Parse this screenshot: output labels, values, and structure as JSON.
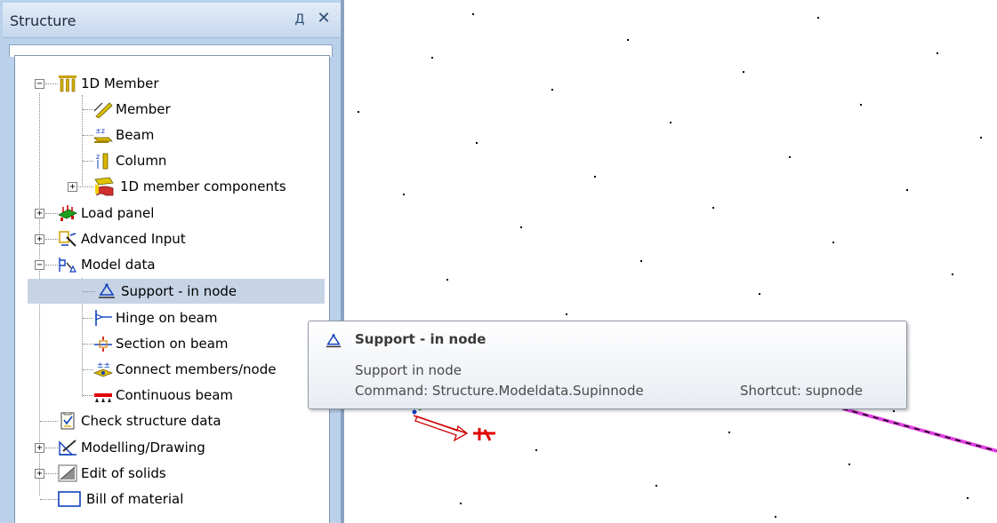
{
  "panel": {
    "title": "Structure",
    "pin_glyph": "Д",
    "close_glyph": "✕"
  },
  "tree": {
    "items": [
      {
        "label": "1D Member",
        "expander": "−",
        "icon": "1d-member-icon"
      },
      {
        "label": "Member",
        "icon": "member-icon"
      },
      {
        "label": "Beam",
        "icon": "beam-icon"
      },
      {
        "label": "Column",
        "icon": "column-icon"
      },
      {
        "label": "1D member components",
        "expander": "+",
        "icon": "1d-member-components-icon"
      },
      {
        "label": "Load panel",
        "expander": "+",
        "icon": "load-panel-icon"
      },
      {
        "label": "Advanced Input",
        "expander": "+",
        "icon": "advanced-input-icon"
      },
      {
        "label": "Model data",
        "expander": "−",
        "icon": "model-data-icon"
      },
      {
        "label": "Support - in node",
        "icon": "support-node-icon",
        "selected": true
      },
      {
        "label": "Hinge on beam",
        "icon": "hinge-icon"
      },
      {
        "label": "Section on beam",
        "icon": "section-icon"
      },
      {
        "label": "Connect members/node",
        "icon": "connect-icon"
      },
      {
        "label": "Continuous beam",
        "icon": "continuous-beam-icon"
      },
      {
        "label": "Check structure data",
        "icon": "check-structure-icon"
      },
      {
        "label": "Modelling/Drawing",
        "expander": "+",
        "icon": "modelling-icon"
      },
      {
        "label": "Edit of solids",
        "expander": "+",
        "icon": "edit-solids-icon"
      },
      {
        "label": "Bill of material",
        "icon": "bill-of-material-icon"
      }
    ]
  },
  "tooltip": {
    "title": "Support - in node",
    "description": "Support in node",
    "command": "Command: Structure.Modeldata.Supinnode",
    "shortcut": "Shortcut: supnode"
  },
  "colors": {
    "panel_bg": "#b9d1ea",
    "selection": "#c6d4e6",
    "member_magenta": "#e040e0",
    "support_red": "#e00000"
  }
}
